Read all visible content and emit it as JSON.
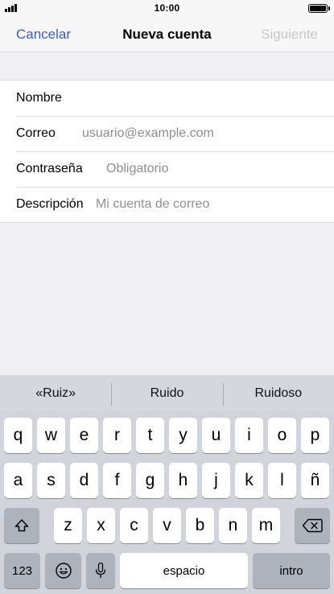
{
  "status_bar": {
    "time": "10:00"
  },
  "nav": {
    "cancel_label": "Cancelar",
    "title": "Nueva cuenta",
    "next_label": "Siguiente"
  },
  "form": {
    "rows": [
      {
        "label": "Nombre",
        "value": "",
        "placeholder": ""
      },
      {
        "label": "Correo",
        "value": "",
        "placeholder": "usuario@example.com"
      },
      {
        "label": "Contraseña",
        "value": "",
        "placeholder": "Obligatorio"
      },
      {
        "label": "Descripción",
        "value": "",
        "placeholder": "Mi cuenta de correo"
      }
    ]
  },
  "keyboard": {
    "suggestions": [
      "«Ruiz»",
      "Ruido",
      "Ruidoso"
    ],
    "row1": [
      "q",
      "w",
      "e",
      "r",
      "t",
      "y",
      "u",
      "i",
      "o",
      "p"
    ],
    "row2": [
      "a",
      "s",
      "d",
      "f",
      "g",
      "h",
      "j",
      "k",
      "l",
      "ñ"
    ],
    "row3": [
      "z",
      "x",
      "c",
      "v",
      "b",
      "n",
      "m"
    ],
    "numbers_label": "123",
    "space_label": "espacio",
    "return_label": "intro",
    "icons": {
      "shift": "shift-icon",
      "delete": "delete-icon",
      "emoji": "emoji-icon",
      "dictation": "microphone-icon"
    }
  },
  "colors": {
    "accent": "#3a5cc2",
    "disabled": "#c7c7cc",
    "placeholder": "#8e8e93",
    "keyboard_bg": "#d1d4da"
  }
}
